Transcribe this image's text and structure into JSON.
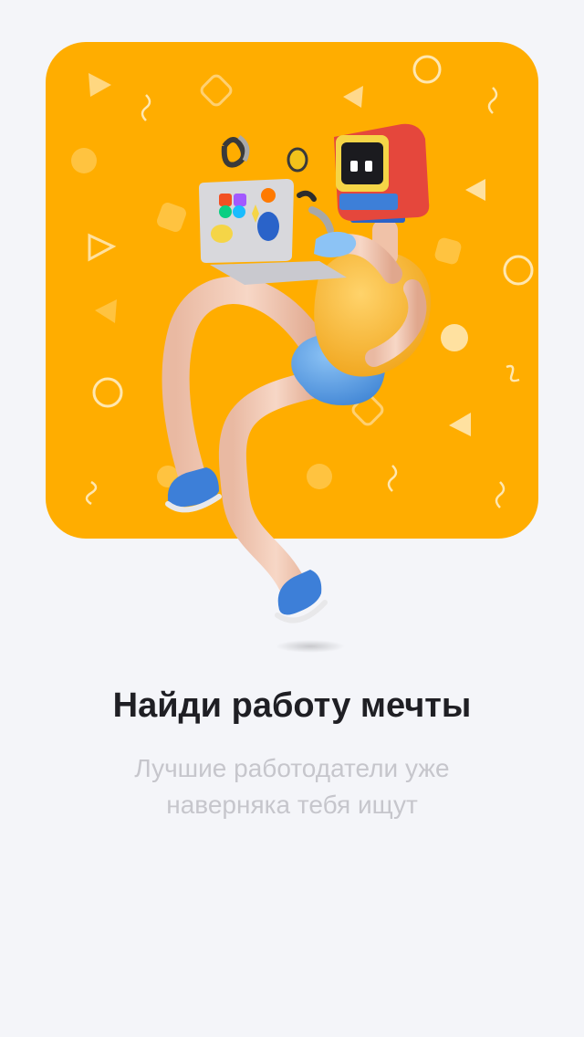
{
  "onboarding": {
    "title": "Найди работу мечты",
    "subtitle": "Лучшие работодатели уже наверняка тебя ищут",
    "illustration": {
      "description_icon": "character-with-laptop-illustration",
      "background_color": "#ffad00"
    }
  },
  "colors": {
    "page_background": "#f4f5f9",
    "card_background": "#ffad00",
    "title": "#1f1f24",
    "subtitle": "#c6c6cc",
    "shirt": "#f5b52a",
    "shorts": "#5ea3e8",
    "monitor_red": "#e5473c"
  }
}
